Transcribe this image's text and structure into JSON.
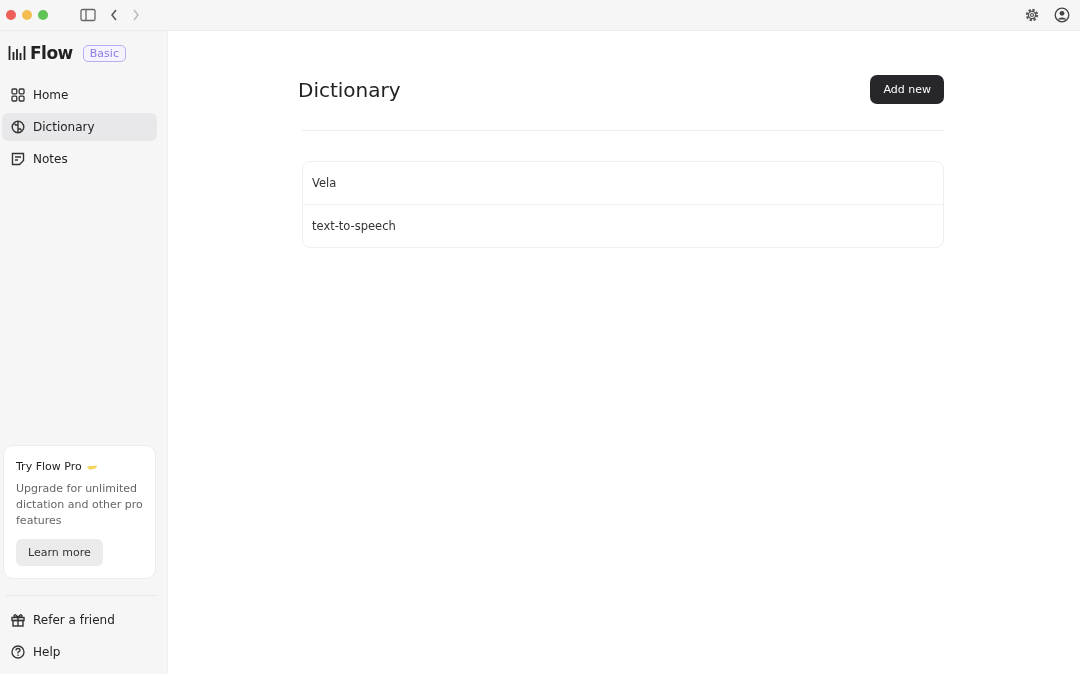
{
  "brand": {
    "name": "Flow",
    "plan": "Basic"
  },
  "nav": [
    {
      "label": "Home",
      "selected": false
    },
    {
      "label": "Dictionary",
      "selected": true
    },
    {
      "label": "Notes",
      "selected": false
    }
  ],
  "promo": {
    "title": "Try Flow Pro",
    "text": "Upgrade for unlimited dictation and other pro features",
    "button": "Learn more"
  },
  "footer_nav": [
    {
      "label": "Refer a friend"
    },
    {
      "label": "Help"
    }
  ],
  "page": {
    "title": "Dictionary",
    "add_button": "Add new"
  },
  "entries": [
    {
      "word": "Vela"
    },
    {
      "word": "text-to-speech"
    }
  ]
}
